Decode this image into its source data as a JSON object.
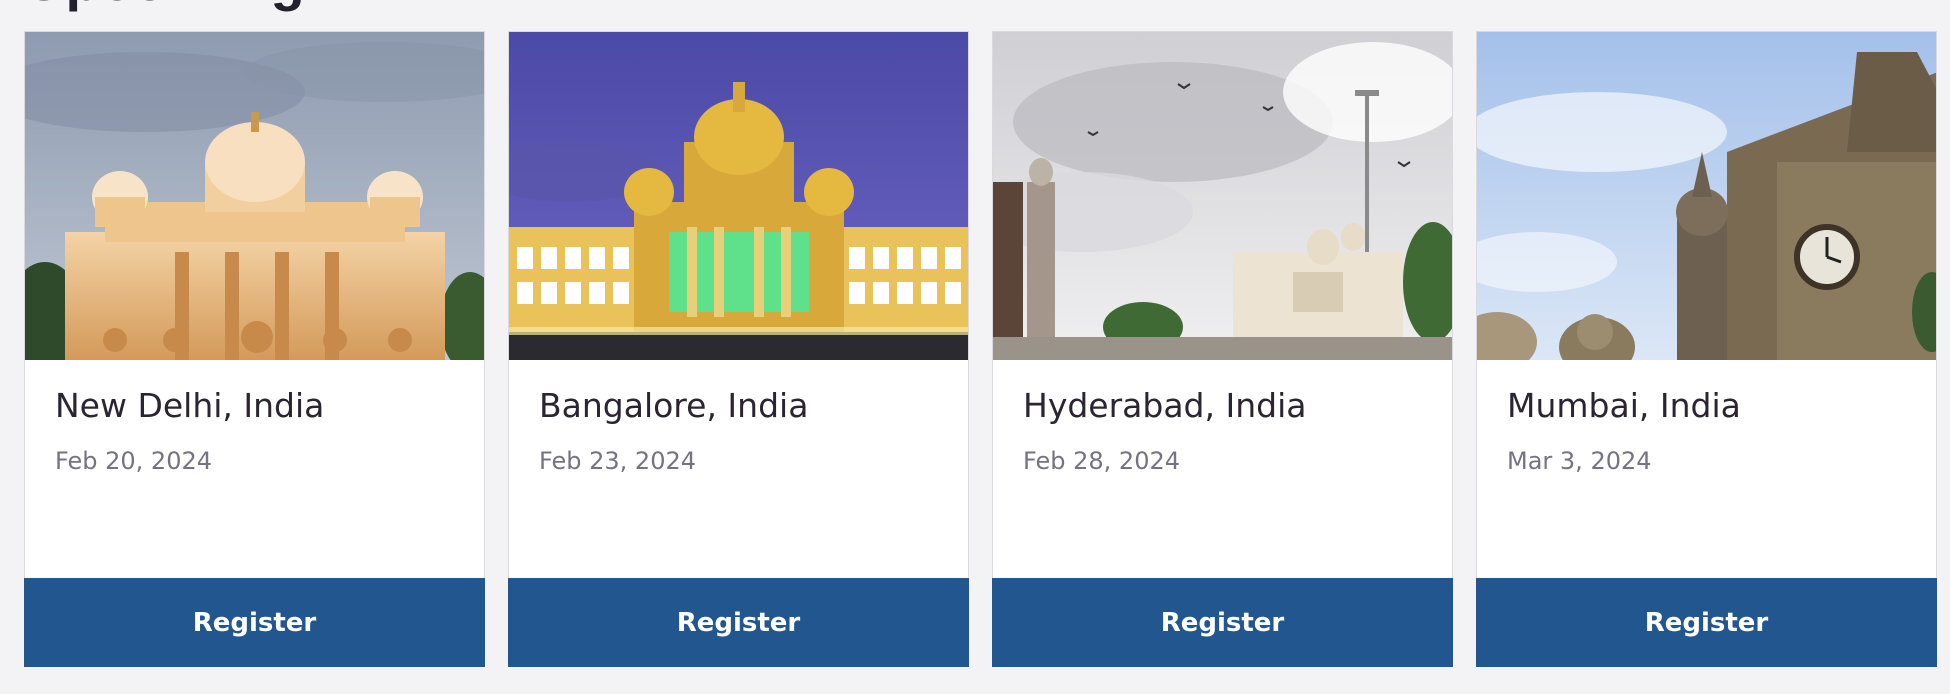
{
  "section": {
    "heading": "Upcoming"
  },
  "cards": [
    {
      "title": "New Delhi, India",
      "date": "Feb 20, 2024",
      "button_label": "Register",
      "image": "rashtrapati-style-palace",
      "sky_top": "#8e9bb0",
      "sky_bottom": "#b9c2cf"
    },
    {
      "title": "Bangalore, India",
      "date": "Feb 23, 2024",
      "button_label": "Register",
      "image": "vidhana-soudha-night",
      "sky_top": "#4b4aa6",
      "sky_bottom": "#6a63c0"
    },
    {
      "title": "Hyderabad, India",
      "date": "Feb 28, 2024",
      "button_label": "Register",
      "image": "charminar-high-court",
      "sky_top": "#d8d8dc",
      "sky_bottom": "#eeeeef"
    },
    {
      "title": "Mumbai, India",
      "date": "Mar 3, 2024",
      "button_label": "Register",
      "image": "cst-station-clock-tower",
      "sky_top": "#a9c4ea",
      "sky_bottom": "#d6e4f5"
    }
  ],
  "colors": {
    "button": "#22568f",
    "page_bg": "#f3f3f5",
    "title": "#2b2431",
    "date": "#767380"
  }
}
